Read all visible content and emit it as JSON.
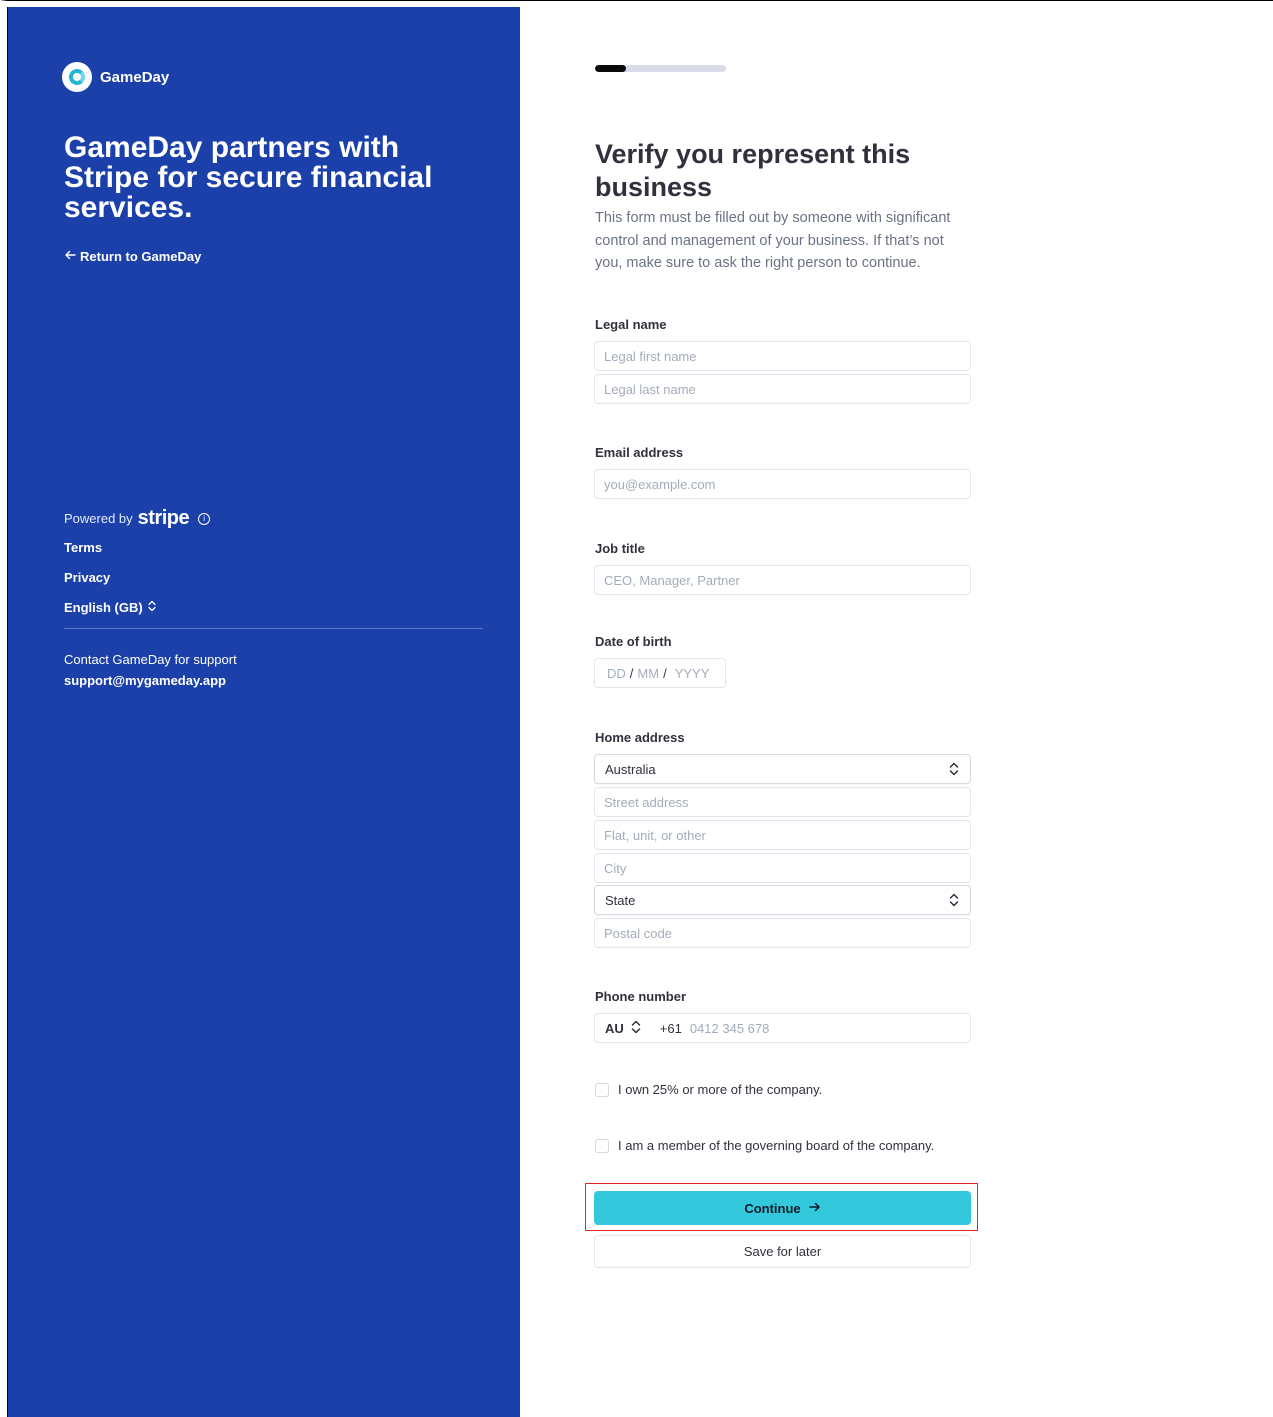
{
  "brand": {
    "name": "GameDay",
    "logo_icon": "gameday-logo-icon"
  },
  "left": {
    "headline": "GameDay partners with Stripe for secure financial services.",
    "return_link": "Return to GameDay",
    "powered_by": "Powered by",
    "stripe": "stripe",
    "links": {
      "terms": "Terms",
      "privacy": "Privacy",
      "language": "English (GB)"
    },
    "support_text": "Contact GameDay for support",
    "support_email": "support@mygameday.app"
  },
  "progress": {
    "value_fraction": 0.24
  },
  "form": {
    "title": "Verify you represent this business",
    "subtitle": "This form must be filled out by someone with significant control and management of your business. If that’s not you, make sure to ask the right person to continue.",
    "legal_name": {
      "label": "Legal name",
      "first_placeholder": "Legal first name",
      "last_placeholder": "Legal last name"
    },
    "email": {
      "label": "Email address",
      "placeholder": "you@example.com"
    },
    "job_title": {
      "label": "Job title",
      "placeholder": "CEO, Manager, Partner"
    },
    "dob": {
      "label": "Date of birth",
      "dd": "DD",
      "mm": "MM",
      "yyyy": "YYYY",
      "sep": "/"
    },
    "address": {
      "label": "Home address",
      "country": "Australia",
      "street_placeholder": "Street address",
      "flat_placeholder": "Flat, unit, or other",
      "city_placeholder": "City",
      "state": "State",
      "postal_placeholder": "Postal code"
    },
    "phone": {
      "label": "Phone number",
      "country_code": "AU",
      "prefix": "+61",
      "placeholder": "0412 345 678"
    },
    "checkboxes": {
      "owner": "I own 25% or more of the company.",
      "board": "I am a member of the governing board of the company."
    },
    "continue_label": "Continue",
    "save_later_label": "Save for later"
  },
  "colors": {
    "left_panel": "#1b40a9",
    "accent_button": "#33c8dc",
    "highlight_box": "#e0262b"
  }
}
